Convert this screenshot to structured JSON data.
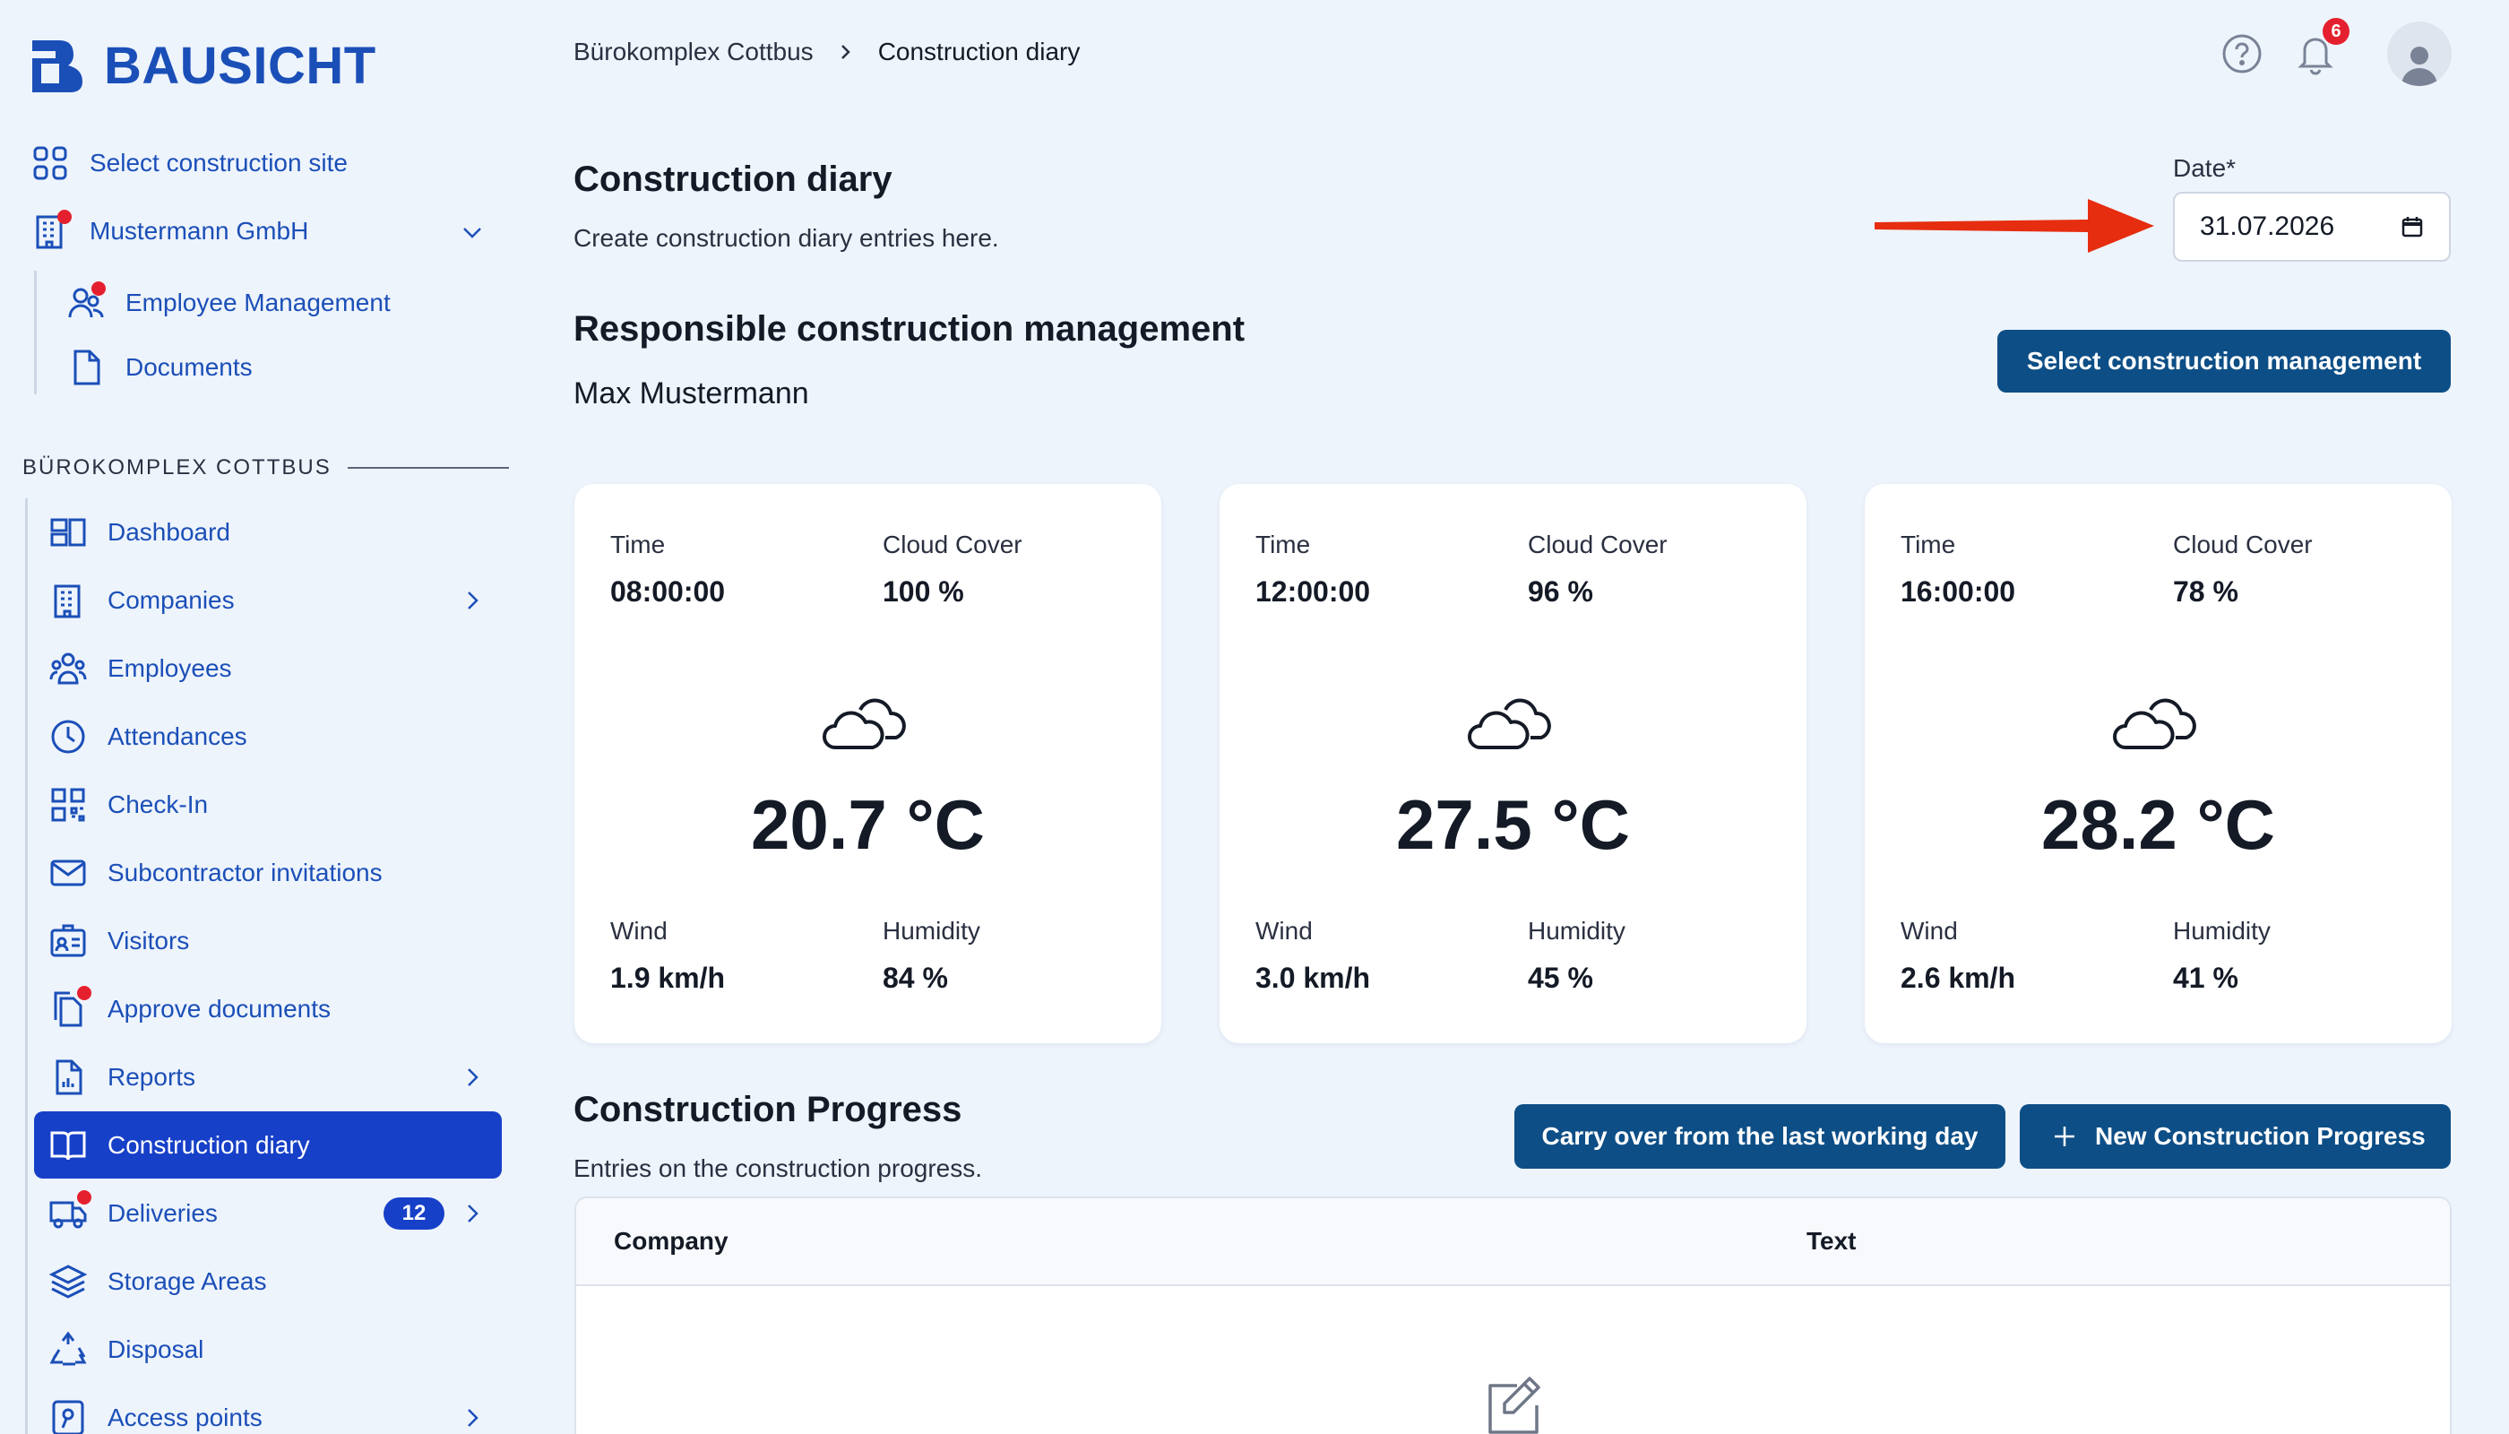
{
  "app": {
    "name": "BAUSICHT"
  },
  "colors": {
    "brand": "#1b4fb8",
    "active": "#1740c8",
    "button": "#0d4e86",
    "alert": "#e5202e"
  },
  "sidebar": {
    "select_site": "Select construction site",
    "company": "Mustermann GmbH",
    "company_items": [
      {
        "label": "Employee Management",
        "icon": "people-icon"
      },
      {
        "label": "Documents",
        "icon": "document-icon"
      }
    ],
    "section_title": "BÜROKOMPLEX COTTBUS",
    "items": [
      {
        "label": "Dashboard",
        "icon": "dashboard-icon"
      },
      {
        "label": "Companies",
        "icon": "building-icon"
      },
      {
        "label": "Employees",
        "icon": "employees-icon"
      },
      {
        "label": "Attendances",
        "icon": "clock-icon"
      },
      {
        "label": "Check-In",
        "icon": "qr-code-icon"
      },
      {
        "label": "Subcontractor invitations",
        "icon": "envelope-icon"
      },
      {
        "label": "Visitors",
        "icon": "id-badge-icon"
      },
      {
        "label": "Approve documents",
        "icon": "documents-icon"
      },
      {
        "label": "Reports",
        "icon": "report-icon"
      },
      {
        "label": "Construction diary",
        "icon": "book-icon",
        "active": true
      },
      {
        "label": "Deliveries",
        "icon": "truck-icon",
        "badge": "12"
      },
      {
        "label": "Storage Areas",
        "icon": "layers-icon"
      },
      {
        "label": "Disposal",
        "icon": "recycle-icon"
      },
      {
        "label": "Access points",
        "icon": "key-icon"
      }
    ]
  },
  "header": {
    "breadcrumb": [
      "Bürokomplex Cottbus",
      "Construction diary"
    ],
    "notifications_count": "6"
  },
  "page": {
    "title": "Construction diary",
    "subtitle": "Create construction diary entries here.",
    "date_label": "Date*",
    "date_value": "31.07.2026",
    "management_title": "Responsible construction management",
    "management_name": "Max Mustermann",
    "select_management_button": "Select construction management"
  },
  "weather_labels": {
    "time": "Time",
    "cloud": "Cloud Cover",
    "wind": "Wind",
    "humidity": "Humidity"
  },
  "weather": [
    {
      "time": "08:00:00",
      "cloud": "100 %",
      "temp": "20.7 °C",
      "wind": "1.9 km/h",
      "humidity": "84 %"
    },
    {
      "time": "12:00:00",
      "cloud": "96 %",
      "temp": "27.5 °C",
      "wind": "3.0 km/h",
      "humidity": "45 %"
    },
    {
      "time": "16:00:00",
      "cloud": "78 %",
      "temp": "28.2 °C",
      "wind": "2.6 km/h",
      "humidity": "41 %"
    }
  ],
  "progress": {
    "title": "Construction Progress",
    "subtitle": "Entries on the construction progress.",
    "carry_over_button": "Carry over from the last working day",
    "new_button": "New Construction Progress",
    "columns": [
      "Company",
      "Text"
    ]
  }
}
